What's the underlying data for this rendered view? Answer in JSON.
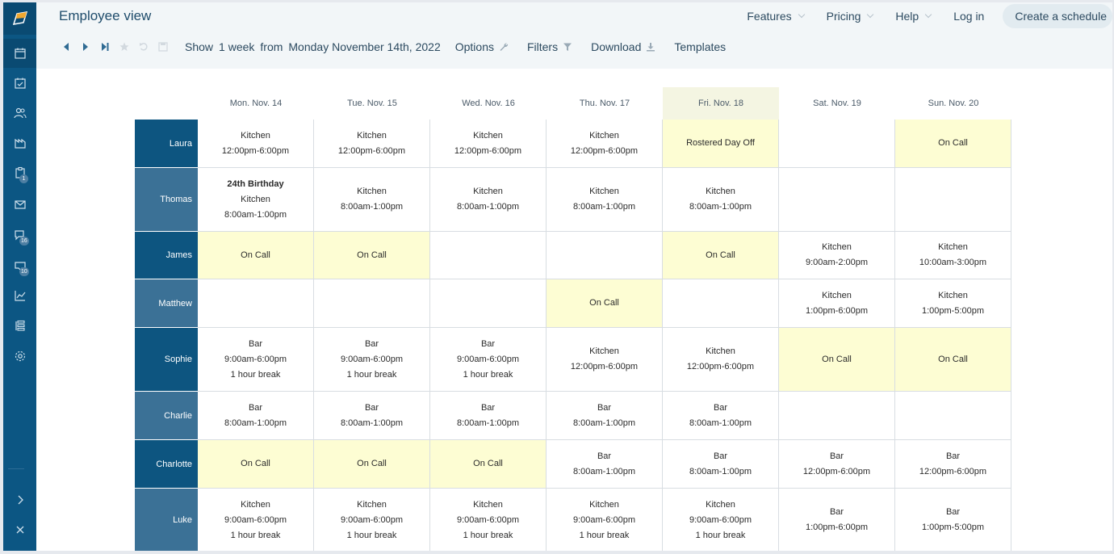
{
  "app": {
    "title": "Employee view"
  },
  "sidebar": {
    "badges": {
      "tasks": "1",
      "messages": "16",
      "inbox": "10"
    }
  },
  "nav": {
    "features": "Features",
    "pricing": "Pricing",
    "help": "Help",
    "login": "Log in",
    "cta": "Create a schedule"
  },
  "toolbar": {
    "show": "Show",
    "duration": "1 week",
    "from": "from",
    "date": "Monday November 14th, 2022",
    "options": "Options",
    "filters": "Filters",
    "download": "Download",
    "templates": "Templates"
  },
  "days": [
    "Mon. Nov. 14",
    "Tue. Nov. 15",
    "Wed. Nov. 16",
    "Thu. Nov. 17",
    "Fri. Nov. 18",
    "Sat. Nov. 19",
    "Sun. Nov. 20"
  ],
  "colors": {
    "sidebar": "#0c5683",
    "on_call": "#fdfdd3",
    "today": "#f4f5e2"
  },
  "employees": [
    {
      "name": "Laura",
      "cells": [
        {
          "lines": [
            "Kitchen",
            "12:00pm-6:00pm"
          ]
        },
        {
          "lines": [
            "Kitchen",
            "12:00pm-6:00pm"
          ]
        },
        {
          "lines": [
            "Kitchen",
            "12:00pm-6:00pm"
          ]
        },
        {
          "lines": [
            "Kitchen",
            "12:00pm-6:00pm"
          ]
        },
        {
          "lines": [
            "Rostered Day Off"
          ],
          "yellow": true
        },
        {
          "lines": []
        },
        {
          "lines": [
            "On Call"
          ],
          "yellow": true
        }
      ]
    },
    {
      "name": "Thomas",
      "cells": [
        {
          "title": "24th Birthday",
          "lines": [
            "Kitchen",
            "8:00am-1:00pm"
          ]
        },
        {
          "lines": [
            "Kitchen",
            "8:00am-1:00pm"
          ]
        },
        {
          "lines": [
            "Kitchen",
            "8:00am-1:00pm"
          ]
        },
        {
          "lines": [
            "Kitchen",
            "8:00am-1:00pm"
          ]
        },
        {
          "lines": [
            "Kitchen",
            "8:00am-1:00pm"
          ]
        },
        {
          "lines": []
        },
        {
          "lines": []
        }
      ]
    },
    {
      "name": "James",
      "cells": [
        {
          "lines": [
            "On Call"
          ],
          "yellow": true
        },
        {
          "lines": [
            "On Call"
          ],
          "yellow": true
        },
        {
          "lines": []
        },
        {
          "lines": []
        },
        {
          "lines": [
            "On Call"
          ],
          "yellow": true
        },
        {
          "lines": [
            "Kitchen",
            "9:00am-2:00pm"
          ]
        },
        {
          "lines": [
            "Kitchen",
            "10:00am-3:00pm"
          ]
        }
      ]
    },
    {
      "name": "Matthew",
      "cells": [
        {
          "lines": []
        },
        {
          "lines": []
        },
        {
          "lines": []
        },
        {
          "lines": [
            "On Call"
          ],
          "yellow": true
        },
        {
          "lines": []
        },
        {
          "lines": [
            "Kitchen",
            "1:00pm-6:00pm"
          ]
        },
        {
          "lines": [
            "Kitchen",
            "1:00pm-5:00pm"
          ]
        }
      ]
    },
    {
      "name": "Sophie",
      "cells": [
        {
          "lines": [
            "Bar",
            "9:00am-6:00pm",
            "1 hour break"
          ]
        },
        {
          "lines": [
            "Bar",
            "9:00am-6:00pm",
            "1 hour break"
          ]
        },
        {
          "lines": [
            "Bar",
            "9:00am-6:00pm",
            "1 hour break"
          ]
        },
        {
          "lines": [
            "Kitchen",
            "12:00pm-6:00pm"
          ]
        },
        {
          "lines": [
            "Kitchen",
            "12:00pm-6:00pm"
          ]
        },
        {
          "lines": [
            "On Call"
          ],
          "yellow": true
        },
        {
          "lines": [
            "On Call"
          ],
          "yellow": true
        }
      ]
    },
    {
      "name": "Charlie",
      "cells": [
        {
          "lines": [
            "Bar",
            "8:00am-1:00pm"
          ]
        },
        {
          "lines": [
            "Bar",
            "8:00am-1:00pm"
          ]
        },
        {
          "lines": [
            "Bar",
            "8:00am-1:00pm"
          ]
        },
        {
          "lines": [
            "Bar",
            "8:00am-1:00pm"
          ]
        },
        {
          "lines": [
            "Bar",
            "8:00am-1:00pm"
          ]
        },
        {
          "lines": []
        },
        {
          "lines": []
        }
      ]
    },
    {
      "name": "Charlotte",
      "cells": [
        {
          "lines": [
            "On Call"
          ],
          "yellow": true
        },
        {
          "lines": [
            "On Call"
          ],
          "yellow": true
        },
        {
          "lines": [
            "On Call"
          ],
          "yellow": true
        },
        {
          "lines": [
            "Bar",
            "8:00am-1:00pm"
          ]
        },
        {
          "lines": [
            "Bar",
            "8:00am-1:00pm"
          ]
        },
        {
          "lines": [
            "Bar",
            "12:00pm-6:00pm"
          ]
        },
        {
          "lines": [
            "Bar",
            "12:00pm-6:00pm"
          ]
        }
      ]
    },
    {
      "name": "Luke",
      "cells": [
        {
          "lines": [
            "Kitchen",
            "9:00am-6:00pm",
            "1 hour break"
          ]
        },
        {
          "lines": [
            "Kitchen",
            "9:00am-6:00pm",
            "1 hour break"
          ]
        },
        {
          "lines": [
            "Kitchen",
            "9:00am-6:00pm",
            "1 hour break"
          ]
        },
        {
          "lines": [
            "Kitchen",
            "9:00am-6:00pm",
            "1 hour break"
          ]
        },
        {
          "lines": [
            "Kitchen",
            "9:00am-6:00pm",
            "1 hour break"
          ]
        },
        {
          "lines": [
            "Bar",
            "1:00pm-6:00pm"
          ]
        },
        {
          "lines": [
            "Bar",
            "1:00pm-5:00pm"
          ]
        }
      ]
    }
  ]
}
